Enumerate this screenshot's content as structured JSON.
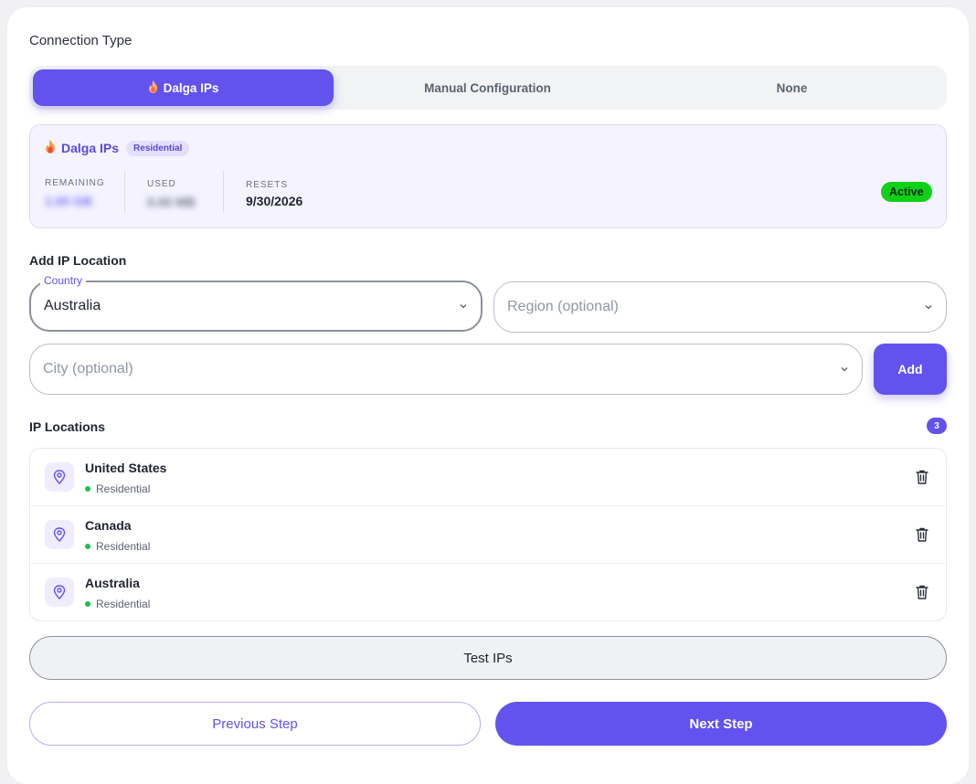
{
  "connection_type": {
    "title": "Connection Type",
    "tabs": [
      {
        "label": "Dalga IPs",
        "active": true
      },
      {
        "label": "Manual Configuration",
        "active": false
      },
      {
        "label": "None",
        "active": false
      }
    ]
  },
  "provider": {
    "name": "Dalga IPs",
    "type_badge": "Residential",
    "stats": {
      "remaining_label": "REMAINING",
      "remaining_value": "1.00 GB",
      "used_label": "USED",
      "used_value": "0.00 MB",
      "resets_label": "RESETS",
      "resets_value": "9/30/2026"
    },
    "status": "Active"
  },
  "add_location": {
    "title": "Add IP Location",
    "country_label": "Country",
    "country_value": "Australia",
    "region_placeholder": "Region (optional)",
    "city_placeholder": "City (optional)",
    "add_label": "Add"
  },
  "ip_locations": {
    "title": "IP Locations",
    "count": "3",
    "items": [
      {
        "name": "United States",
        "type": "Residential"
      },
      {
        "name": "Canada",
        "type": "Residential"
      },
      {
        "name": "Australia",
        "type": "Residential"
      }
    ]
  },
  "actions": {
    "test_label": "Test IPs",
    "prev_label": "Previous Step",
    "next_label": "Next Step"
  },
  "colors": {
    "accent": "#6252ee",
    "active_green": "#10d117",
    "dot_green": "#16c24a"
  }
}
